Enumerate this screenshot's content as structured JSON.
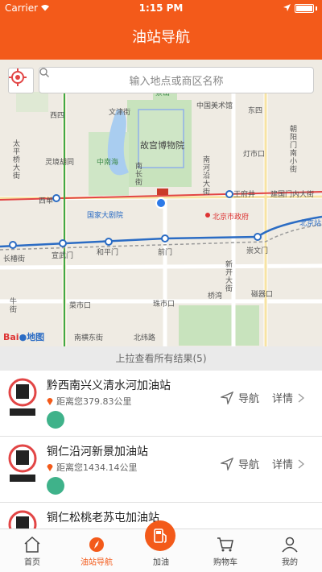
{
  "status_bar": {
    "carrier": "Carrier",
    "time": "1:15 PM"
  },
  "header": {
    "title": "油站导航"
  },
  "search": {
    "placeholder": "输入地点或商区名称"
  },
  "map": {
    "labels": {
      "xisi": "西四",
      "wenjin": "文津街",
      "gugong": "故宫博物院",
      "jingshan": "景山",
      "meishuguan": "中国美术馆",
      "dongsi": "东四",
      "taiping": "太平桥大街",
      "lingjing": "灵境胡同",
      "zhongnanhai": "中南海",
      "nanchang": "南长街",
      "nanhe": "南河沿大街",
      "dengshi": "灯市口",
      "chaoyang": "朝阳门南小街",
      "xidan": "西单",
      "wangfujing": "王府井",
      "jianguomen": "建国门内大街",
      "guojia": "国家大剧院",
      "beijing_gov": "北京市政府",
      "beijing_station": "北京站",
      "changchun": "长椿街",
      "xuanwu": "宣武门",
      "hepingmen": "和平门",
      "qianmen": "前门",
      "chongwen": "崇文门",
      "xinkai": "新开大街",
      "qiaowan": "桥湾",
      "cishikou": "磁器口",
      "caishikou": "菜市口",
      "zhushikou": "珠市口",
      "niujie": "牛街",
      "nanheng": "南横东街",
      "beiwei": "北纬路"
    },
    "logo_bai": "Bai",
    "logo_du": "地图"
  },
  "results": {
    "pull_hint": "上拉查看所有结果(5)",
    "nav_label": "导航",
    "detail_label": "详情",
    "stations": [
      {
        "name": "黔西南兴义清水河加油站",
        "distance": "距离您379.83公里"
      },
      {
        "name": "铜仁沿河新景加油站",
        "distance": "距离您1434.14公里"
      },
      {
        "name": "铜仁松桃老苏屯加油站",
        "distance": ""
      }
    ]
  },
  "tabs": {
    "home": "首页",
    "nav": "油站导航",
    "fuel": "加油",
    "cart": "购物车",
    "mine": "我的"
  },
  "colors": {
    "accent": "#f35a1a",
    "badge": "#3fb28a"
  }
}
